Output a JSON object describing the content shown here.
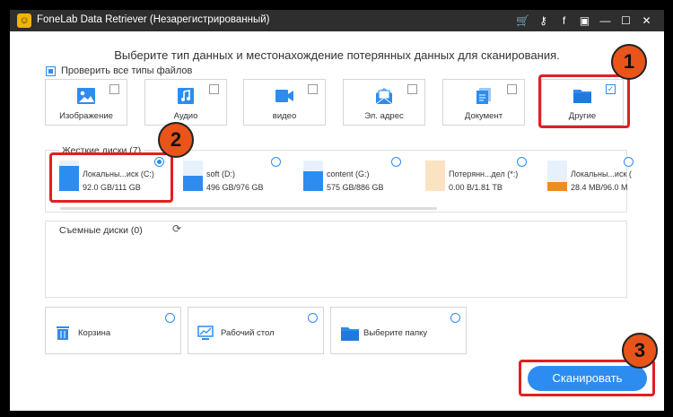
{
  "window": {
    "title": "FoneLab Data Retriever (Незарегистрированный)",
    "titlebar_buttons": [
      {
        "name": "cart-icon",
        "glyph": "🛒"
      },
      {
        "name": "key-icon",
        "glyph": "⚷"
      },
      {
        "name": "facebook-icon",
        "glyph": "f"
      },
      {
        "name": "feedback-icon",
        "glyph": "▣"
      },
      {
        "name": "minimize-icon",
        "glyph": "—"
      },
      {
        "name": "maximize-icon",
        "glyph": "☐"
      },
      {
        "name": "close-icon",
        "glyph": "✕"
      }
    ]
  },
  "heading": "Выберите тип данных и местонахождение потерянных данных для сканирования.",
  "check_all_label": "Проверить все типы файлов",
  "file_types": [
    {
      "label": "Изображение",
      "icon": "image-icon",
      "checked": false
    },
    {
      "label": "Аудио",
      "icon": "audio-icon",
      "checked": false
    },
    {
      "label": "видео",
      "icon": "video-icon",
      "checked": false
    },
    {
      "label": "Эл. адрес",
      "icon": "email-icon",
      "checked": false
    },
    {
      "label": "Документ",
      "icon": "document-icon",
      "checked": false
    },
    {
      "label": "Другие",
      "icon": "folder-icon",
      "checked": true
    }
  ],
  "hard_drives": {
    "title": "Жесткие диски (7)",
    "drives": [
      {
        "name": "Локальны...иск (C:)",
        "size": "92.0 GB/111 GB",
        "selected": true,
        "color": "#2d8cf0",
        "fill": 0.83
      },
      {
        "name": "soft (D:)",
        "size": "496 GB/976 GB",
        "selected": false,
        "color": "#2d8cf0",
        "fill": 0.51
      },
      {
        "name": "content (G:)",
        "size": "575 GB/886 GB",
        "selected": false,
        "color": "#2d8cf0",
        "fill": 0.65
      },
      {
        "name": "Потерянн...дел (*:)",
        "size": "0.00  B/1.81 TB",
        "selected": false,
        "color": "#f7c98a",
        "fill": 0
      },
      {
        "name": "Локальны...иск (",
        "size": "28.4 MB/96.0 M",
        "selected": false,
        "color": "#f08c1e",
        "fill": 0.3
      }
    ]
  },
  "removable": {
    "title": "Съемные диски (0)"
  },
  "locations": [
    {
      "label": "Корзина",
      "icon": "trash-icon"
    },
    {
      "label": "Рабочий стол",
      "icon": "desktop-icon"
    },
    {
      "label": "Выберите папку",
      "icon": "folder-icon"
    }
  ],
  "scan_label": "Сканировать",
  "badges": [
    "1",
    "2",
    "3"
  ],
  "colors": {
    "accent": "#2d8cf0",
    "highlight": "#e02020",
    "badge": "#e8541a"
  }
}
